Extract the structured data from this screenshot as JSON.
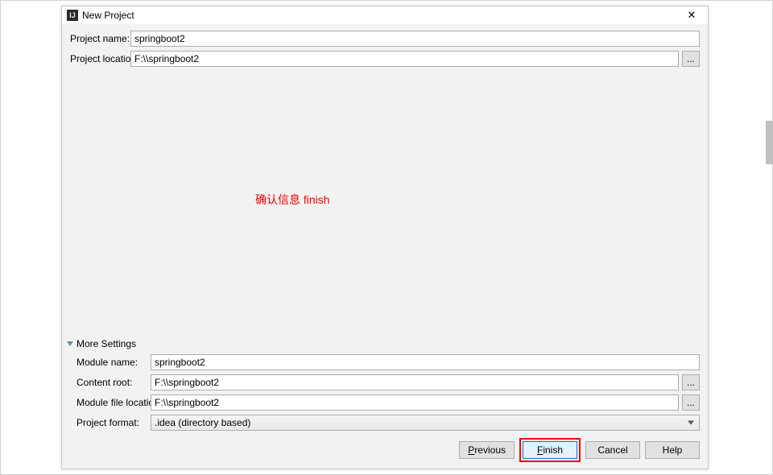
{
  "window": {
    "title": "New Project",
    "close_glyph": "✕"
  },
  "fields": {
    "project_name_label": "Project name:",
    "project_name_value": "springboot2",
    "project_location_label": "Project location:",
    "project_location_value": "F:\\\\springboot2",
    "browse_glyph": "..."
  },
  "annotation": {
    "text": "确认信息  finish"
  },
  "more": {
    "header": "More Settings",
    "module_name_label": "Module name:",
    "module_name_value": "springboot2",
    "content_root_label": "Content root:",
    "content_root_value": "F:\\\\springboot2",
    "module_file_loc_label": "Module file location:",
    "module_file_loc_value": "F:\\\\springboot2",
    "project_format_label": "Project format:",
    "project_format_value": ".idea (directory based)"
  },
  "buttons": {
    "previous": "Previous",
    "previous_accel": "P",
    "finish": "Finish",
    "finish_accel": "F",
    "cancel": "Cancel",
    "help": "Help"
  }
}
